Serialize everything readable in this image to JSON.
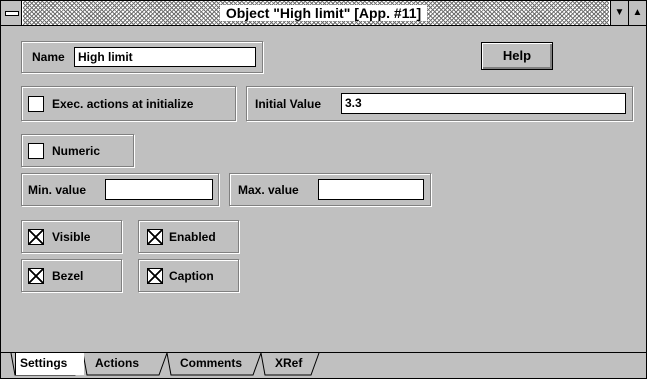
{
  "window": {
    "title": "Object \"High limit\" [App. #11]",
    "icons": {
      "system_menu": "system-menu-icon",
      "minimize": "down-arrow-icon",
      "maximize": "up-arrow-icon"
    }
  },
  "fields": {
    "name_label": "Name",
    "name_value": "High limit",
    "exec_actions_label": "Exec. actions at initialize",
    "exec_actions_checked": false,
    "initial_value_label": "Initial Value",
    "initial_value": "3.3",
    "numeric_label": "Numeric",
    "numeric_checked": false,
    "min_value_label": "Min. value",
    "min_value": "",
    "max_value_label": "Max. value",
    "max_value": ""
  },
  "options": {
    "visible_label": "Visible",
    "visible_checked": true,
    "enabled_label": "Enabled",
    "enabled_checked": true,
    "bezel_label": "Bezel",
    "bezel_checked": true,
    "caption_label": "Caption",
    "caption_checked": true
  },
  "buttons": {
    "help_label": "Help"
  },
  "tabs": [
    {
      "label": "Settings",
      "active": true
    },
    {
      "label": "Actions",
      "active": false
    },
    {
      "label": "Comments",
      "active": false
    },
    {
      "label": "XRef",
      "active": false
    }
  ],
  "colors": {
    "face": "#c0c0c0",
    "shadow": "#808080",
    "highlight": "#ffffff"
  }
}
